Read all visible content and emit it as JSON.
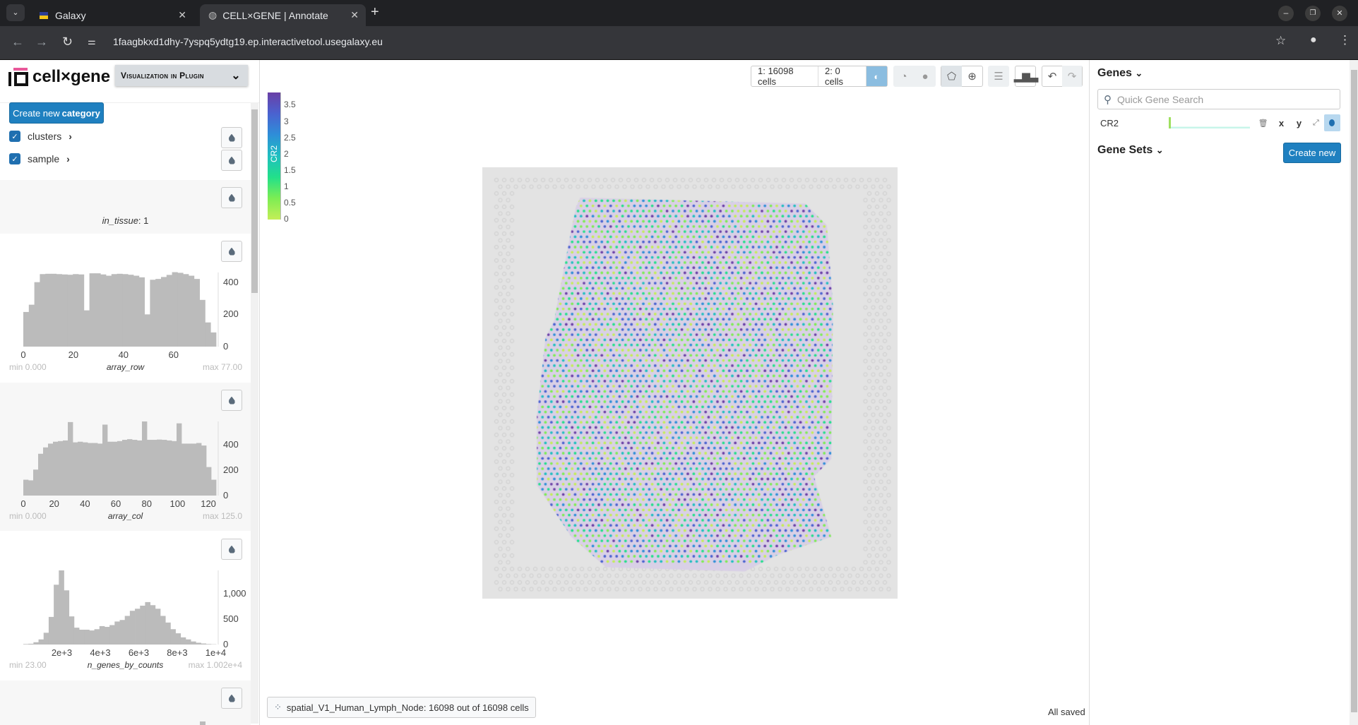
{
  "browser": {
    "tabs": [
      {
        "label": "Galaxy"
      },
      {
        "label": "CELL×GENE | Annotate"
      }
    ],
    "url": "1faagbkxd1dhy-7yspq5ydtg19.ep.interactivetool.usegalaxy.eu"
  },
  "app": {
    "logo": "cell×gene",
    "plugin_select": "Visualization in Plugin"
  },
  "sidebar": {
    "create_btn_normal": "Create new ",
    "create_btn_bold": "category",
    "categories": [
      {
        "label": "clusters",
        "checked": true
      },
      {
        "label": "sample",
        "checked": true
      }
    ],
    "in_tissue": {
      "name": "in_tissue",
      "value": ": 1"
    }
  },
  "chart_data": [
    {
      "type": "bar",
      "field": "array_row",
      "min_label": "min 0.000",
      "max_label": "max 77.00",
      "xlim": [
        0,
        77
      ],
      "ylim": [
        0,
        460
      ],
      "xticks": [
        "0",
        "20",
        "40",
        "60"
      ],
      "xtick_values": [
        0,
        20,
        40,
        60
      ],
      "yticks": [
        "0",
        "200",
        "400"
      ],
      "ytick_values": [
        0,
        200,
        400
      ],
      "bins": [
        215,
        260,
        400,
        450,
        452,
        452,
        450,
        448,
        446,
        450,
        448,
        225,
        455,
        455,
        448,
        440,
        450,
        452,
        450,
        446,
        440,
        430,
        200,
        415,
        420,
        432,
        445,
        462,
        458,
        450,
        440,
        420,
        290,
        150,
        88
      ]
    },
    {
      "type": "bar",
      "field": "array_col",
      "min_label": "min 0.000",
      "max_label": "max 125.0",
      "xlim": [
        0,
        125
      ],
      "ylim": [
        0,
        585
      ],
      "xticks": [
        "0",
        "20",
        "40",
        "60",
        "80",
        "100",
        "120"
      ],
      "xtick_values": [
        0,
        20,
        40,
        60,
        80,
        100,
        120
      ],
      "yticks": [
        "0",
        "200",
        "400"
      ],
      "ytick_values": [
        0,
        200,
        400
      ],
      "bins": [
        125,
        120,
        205,
        330,
        380,
        410,
        425,
        430,
        435,
        580,
        420,
        425,
        420,
        415,
        415,
        410,
        560,
        425,
        425,
        430,
        440,
        445,
        440,
        435,
        585,
        440,
        440,
        442,
        440,
        435,
        430,
        570,
        410,
        410,
        410,
        415,
        395,
        225,
        125
      ]
    },
    {
      "type": "bar",
      "field": "n_genes_by_counts",
      "min_label": "min 23.00",
      "max_label": "max 1.002e+4",
      "xlim": [
        0,
        10020
      ],
      "ylim": [
        0,
        1450
      ],
      "xticks": [
        "2e+3",
        "4e+3",
        "6e+3",
        "8e+3",
        "1e+4"
      ],
      "xtick_values": [
        2000,
        4000,
        6000,
        8000,
        10000
      ],
      "yticks": [
        "0",
        "500",
        "1,000"
      ],
      "ytick_values": [
        0,
        500,
        1000
      ],
      "bins": [
        10,
        15,
        45,
        100,
        230,
        540,
        1170,
        1450,
        1060,
        550,
        330,
        290,
        290,
        275,
        300,
        360,
        345,
        380,
        450,
        480,
        560,
        660,
        700,
        760,
        830,
        770,
        700,
        560,
        430,
        300,
        220,
        140,
        100,
        60,
        35,
        20,
        10,
        5
      ]
    }
  ],
  "colorbar": {
    "gene": "CR2",
    "ticks": [
      "3.5",
      "3",
      "2.5",
      "2",
      "1.5",
      "1",
      "0.5",
      "0"
    ],
    "colors": [
      "#6a3fa6",
      "#4a62d0",
      "#2e8ed8",
      "#1fbfc0",
      "#22e08a",
      "#7ded53",
      "#c4ee57"
    ]
  },
  "toolbar": {
    "set1": "1: 16098 cells",
    "set2": "2: 0 cells"
  },
  "status": {
    "embedding": "spatial_V1_Human_Lymph_Node: 16098 out of 16098 cells",
    "saved": "All saved"
  },
  "genes": {
    "title": "Genes",
    "search_placeholder": "Quick Gene Search",
    "items": [
      {
        "name": "CR2",
        "x": "x",
        "y": "y"
      }
    ],
    "gene_sets_title": "Gene Sets",
    "create_new": "Create new"
  }
}
